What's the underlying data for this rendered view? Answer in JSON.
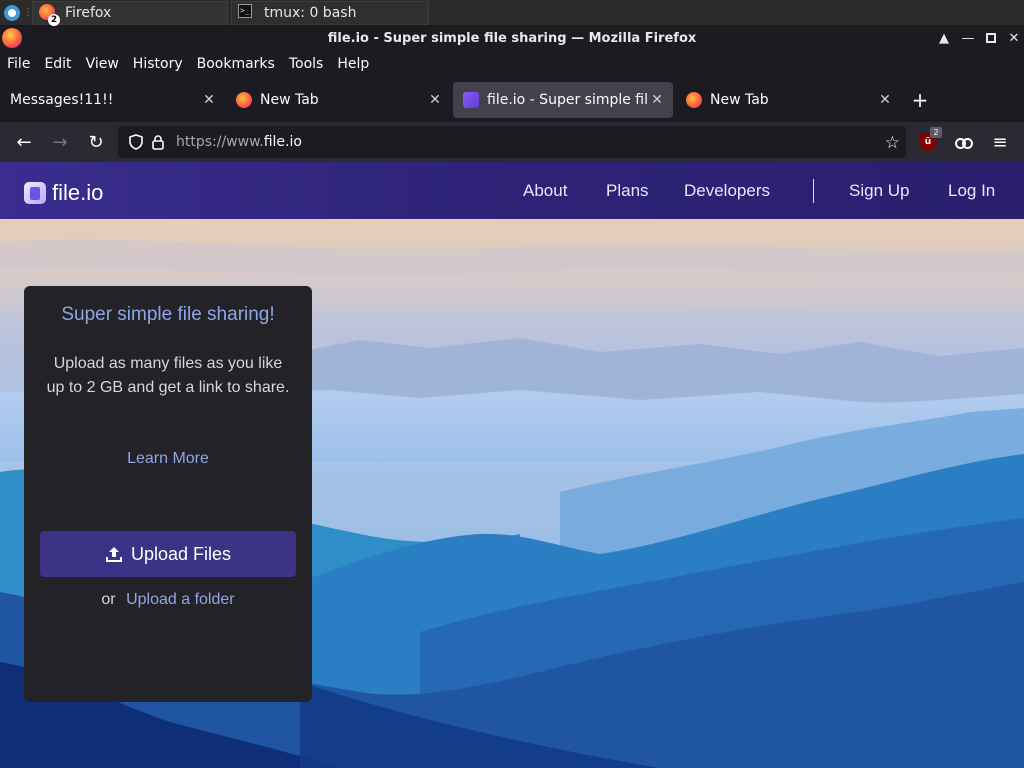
{
  "taskbar": {
    "tasks": [
      {
        "label": "Firefox",
        "badge": "2"
      },
      {
        "label": "tmux: 0 bash"
      }
    ]
  },
  "window": {
    "title": "file.io - Super simple file sharing — Mozilla Firefox"
  },
  "menu": [
    "File",
    "Edit",
    "View",
    "History",
    "Bookmarks",
    "Tools",
    "Help"
  ],
  "tabs": [
    {
      "label": "Messages!11!!",
      "icon": "none",
      "active": false
    },
    {
      "label": "New Tab",
      "icon": "firefox-icon",
      "active": false
    },
    {
      "label": "file.io - Super simple file sharing",
      "icon": "fileio-icon",
      "active": true
    },
    {
      "label": "New Tab",
      "icon": "firefox-icon",
      "active": false
    }
  ],
  "toolbar": {
    "url_prefix": "https://www.",
    "url_domain": "file.io",
    "ublock_badge": "2"
  },
  "site": {
    "logo_text": "file.io",
    "nav": [
      "About",
      "Plans",
      "Developers",
      "Sign Up",
      "Log In"
    ],
    "card": {
      "title": "Super simple file sharing!",
      "description": "Upload as many files as you like up to 2 GB and get a link to share.",
      "learn_more": "Learn More",
      "upload_button": "Upload Files",
      "or_text": "or",
      "upload_folder": "Upload a folder"
    }
  },
  "colors": {
    "brand": "#3c3286",
    "link": "#8fa6e6",
    "header_bg": "#2e2378"
  }
}
